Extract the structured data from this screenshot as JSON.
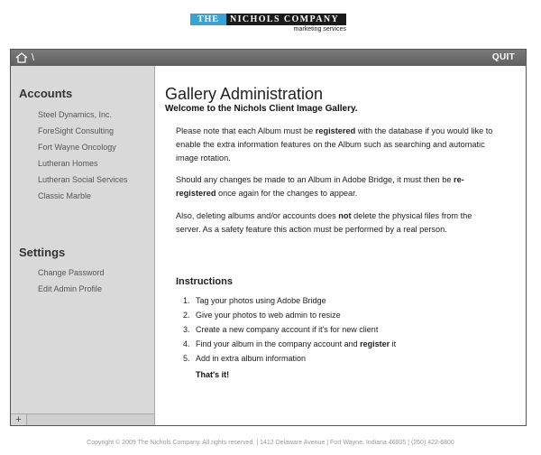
{
  "logo": {
    "the": "THE",
    "name": "NICHOLS COMPANY",
    "tagline": "marketing services"
  },
  "titlebar": {
    "separator": "\\",
    "quit_label": "QUIT"
  },
  "sidebar": {
    "accounts_heading": "Accounts",
    "accounts": [
      "Steel Dynamics, Inc.",
      "ForeSight Consulting",
      "Fort Wayne Oncology",
      "Lutheran Homes",
      "Lutheran Social Services",
      "Classic Marble"
    ],
    "settings_heading": "Settings",
    "settings": [
      "Change Password",
      "Edit Admin Profile"
    ],
    "add_label": "+"
  },
  "main": {
    "title": "Gallery Administration",
    "subtitle": "Welcome to the Nichols Client Image Gallery.",
    "para1": {
      "a": "Please note that each Album must be ",
      "b": "registered",
      "c": " with the database if you would like to enable the extra information features on the Album such as searching and automatic image rotation."
    },
    "para2": {
      "a": "Should any changes be made to an Album in Adobe Bridge, it must then be ",
      "b": "re-registered",
      "c": " once again for the changes to appear."
    },
    "para3": {
      "a": "Also, deleting albums and/or accounts does ",
      "b": "not",
      "c": " delete the physical files from the server. As a safety feature this action must be performed by a real person."
    },
    "instructions_heading": "Instructions",
    "steps": [
      {
        "num": "1.",
        "text": "Tag your photos using Adobe Bridge"
      },
      {
        "num": "2.",
        "text": "Give your photos to web admin to resize"
      },
      {
        "num": "3.",
        "text": "Create a new company account if it's for new client"
      },
      {
        "num": "4.",
        "text": "Find your album in the company account and ",
        "bold": "register",
        "after": " it"
      },
      {
        "num": "5.",
        "text": "Add in extra album information"
      }
    ],
    "closing": "That's it!"
  },
  "footer": {
    "text": "Copyright © 2009 The Nichols Company. All rights reserved. | 1412 Delaware Avenue | Fort Wayne, Indiana 46805 | (260) 422-6800"
  }
}
